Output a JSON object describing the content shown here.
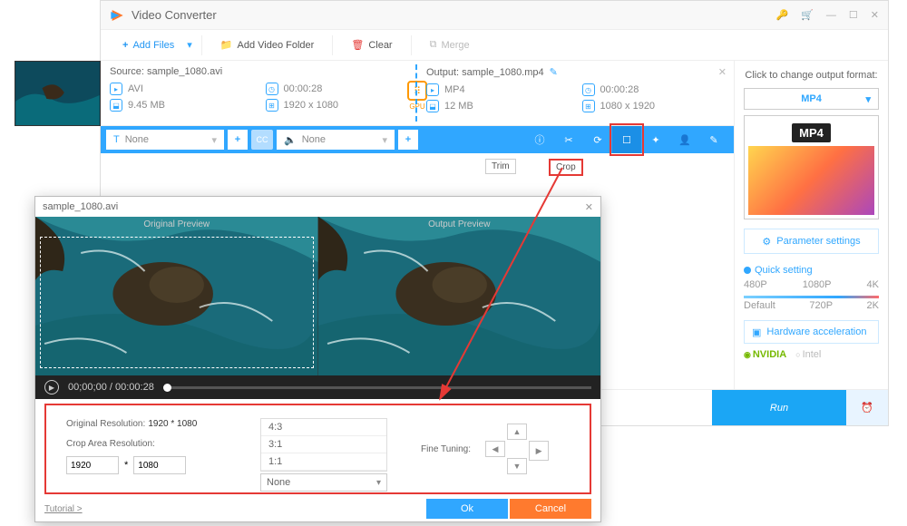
{
  "app": {
    "title": "Video Converter"
  },
  "toolbar": {
    "add_files": "Add Files",
    "add_folder": "Add Video Folder",
    "clear": "Clear",
    "merge": "Merge"
  },
  "file": {
    "source_label": "Source: sample_1080.avi",
    "output_label": "Output: sample_1080.mp4",
    "src": {
      "fmt": "AVI",
      "dur": "00:00:28",
      "size": "9.45 MB",
      "res": "1920 x 1080"
    },
    "out": {
      "fmt": "MP4",
      "dur": "00:00:28",
      "size": "12 MB",
      "res": "1080 x 1920"
    },
    "gpu": "GPU"
  },
  "opts": {
    "subtitle": "None",
    "audio": "None",
    "trim_tip": "Trim",
    "crop_tip": "Crop"
  },
  "sidebar": {
    "hint": "Click to change output format:",
    "fmt": "MP4",
    "fmt_badge": "MP4",
    "param": "Parameter settings",
    "quick": "Quick setting",
    "ticks_top": [
      "480P",
      "1080P",
      "4K"
    ],
    "ticks_bot": [
      "Default",
      "720P",
      "2K"
    ],
    "hw": "Hardware acceleration",
    "nvidia": "NVIDIA",
    "intel": "Intel"
  },
  "run": "Run",
  "crop": {
    "title": "sample_1080.avi",
    "orig_label": "Original Preview",
    "out_label": "Output Preview",
    "time": "00;00;00 / 00:00:28",
    "orig_res_label": "Original Resolution:",
    "orig_res": "1920 * 1080",
    "crop_res_label": "Crop Area Resolution:",
    "w": "1920",
    "h": "1080",
    "ratios": [
      "4:3",
      "3:1",
      "1:1"
    ],
    "ratio_sel": "None",
    "fine": "Fine Tuning:",
    "tutorial": "Tutorial >",
    "ok": "Ok",
    "cancel": "Cancel"
  }
}
